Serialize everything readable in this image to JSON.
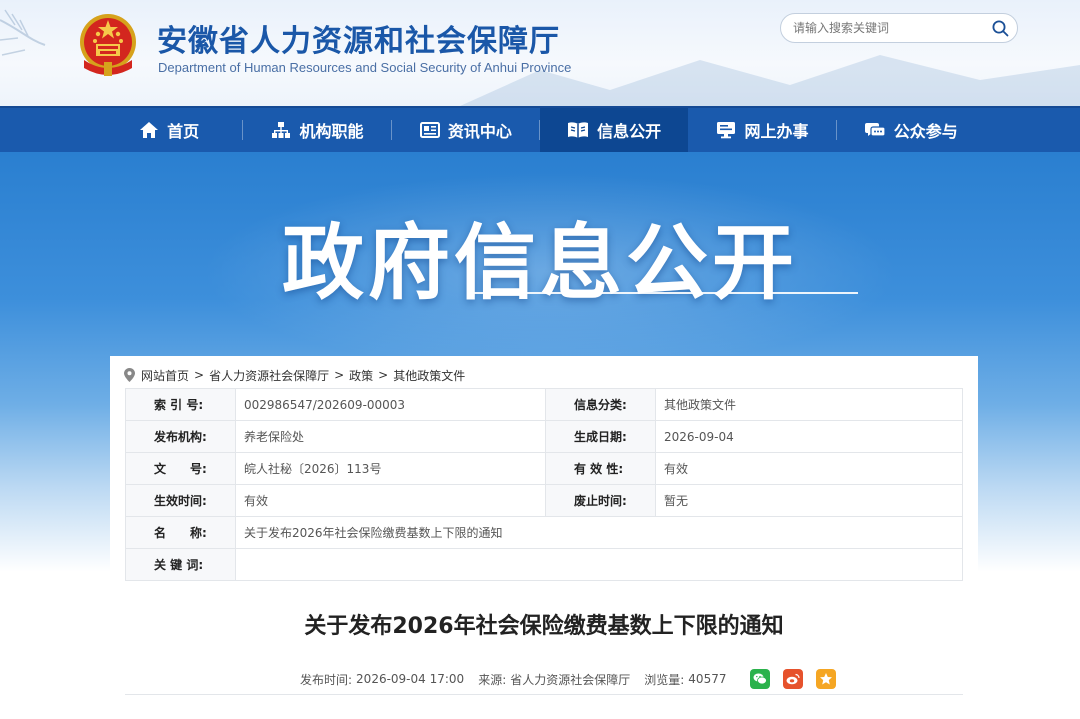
{
  "header": {
    "title": "安徽省人力资源和社会保障厅",
    "subtitle": "Department of Human Resources and Social Security of Anhui Province",
    "search_placeholder": "请输入搜索关键词"
  },
  "nav": {
    "items": [
      {
        "label": "首页",
        "icon": "home-icon"
      },
      {
        "label": "机构职能",
        "icon": "org-chart-icon"
      },
      {
        "label": "资讯中心",
        "icon": "news-icon"
      },
      {
        "label": "信息公开",
        "icon": "open-book-icon",
        "active": true
      },
      {
        "label": "网上办事",
        "icon": "monitor-icon"
      },
      {
        "label": "公众参与",
        "icon": "chat-icon"
      }
    ]
  },
  "banner": {
    "title": "政府信息公开"
  },
  "breadcrumb": [
    "网站首页",
    "省人力资源社会保障厅",
    "政策",
    "其他政策文件"
  ],
  "meta": {
    "index_no_label": "索 引 号:",
    "index_no": "002986547/202609-00003",
    "category_label": "信息分类:",
    "category": "其他政策文件",
    "issuer_label": "发布机构:",
    "issuer": "养老保险处",
    "created_label": "生成日期:",
    "created": "2026-09-04",
    "doc_no_label": "文　　号:",
    "doc_no": "皖人社秘〔2026〕113号",
    "validity_label": "有 效 性:",
    "validity": "有效",
    "effective_label": "生效时间:",
    "effective": "有效",
    "repeal_label": "废止时间:",
    "repeal": "暂无",
    "name_label": "名　　称:",
    "name": "关于发布2026年社会保险缴费基数上下限的通知",
    "keywords_label": "关 键 词:",
    "keywords": ""
  },
  "article": {
    "title": "关于发布2026年社会保险缴费基数上下限的通知",
    "publish_label": "发布时间:",
    "publish_time": "2026-09-04 17:00",
    "source_label": "来源:",
    "source": "省人力资源社会保障厅",
    "views_label": "浏览量:",
    "views": "40577"
  },
  "colors": {
    "nav_bg": "#1a5aad",
    "nav_active": "#0d4792",
    "title_blue": "#1a57a8",
    "wechat": "#2bb24c",
    "weibo": "#e6522c",
    "favorite": "#f5a623"
  }
}
